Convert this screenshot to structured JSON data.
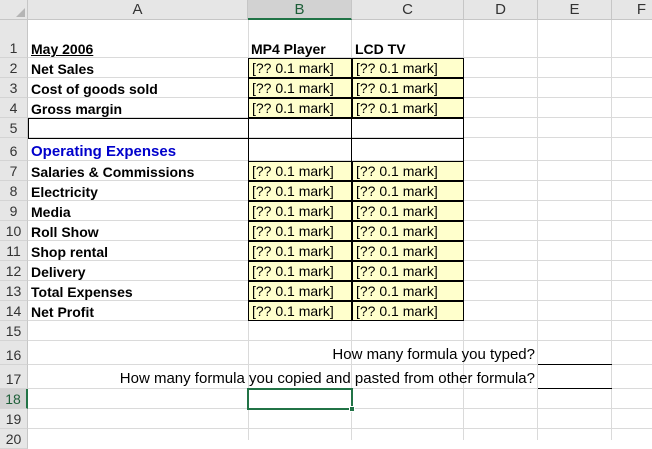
{
  "columns": [
    "A",
    "B",
    "C",
    "D",
    "E",
    "F"
  ],
  "rows": [
    "1",
    "2",
    "3",
    "4",
    "5",
    "6",
    "7",
    "8",
    "9",
    "10",
    "11",
    "12",
    "13",
    "14",
    "15",
    "16",
    "17",
    "18",
    "19",
    "20"
  ],
  "header": {
    "title": "May 2006",
    "col_b": "MP4 Player",
    "col_c": "LCD TV"
  },
  "section_heading": "Operating Expenses",
  "row_labels": {
    "r2": "Net Sales",
    "r3": "Cost of goods sold",
    "r4": "Gross margin",
    "r7": "Salaries & Commissions",
    "r8": "Electricity",
    "r9": "Media",
    "r10": "Roll Show",
    "r11": "Shop rental",
    "r12": "Delivery",
    "r13": "Total Expenses",
    "r14": "Net Profit"
  },
  "placeholder": "[?? 0.1 mark]",
  "questions": {
    "q1": "How many formula you typed?",
    "q2": "How many formula you copied and pasted from other formula?"
  },
  "selected_cell": "B18",
  "colors": {
    "input_fill": "#ffffcc",
    "heading_blue": "#0000cc",
    "selection_green": "#217346"
  }
}
